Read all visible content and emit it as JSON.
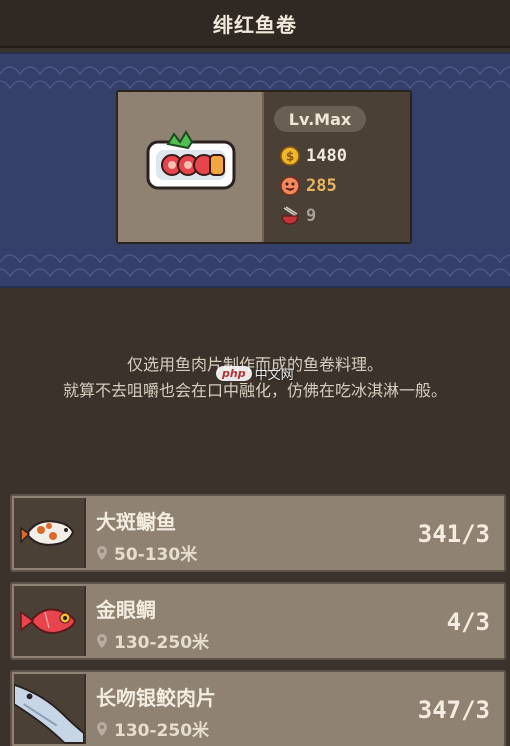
{
  "header": {
    "title": "绯红鱼卷"
  },
  "dish": {
    "image_icon": "salmon-roll-icon",
    "level": "Lv.Max",
    "price": "1480",
    "appeal": "285",
    "portions": "9"
  },
  "description": {
    "line1": "仅选用鱼肉片制作而成的鱼卷料理。",
    "line2": "就算不去咀嚼也会在口中融化，仿佛在吃冰淇淋一般。"
  },
  "watermark": {
    "badge": "php",
    "text": "中文网"
  },
  "ingredients": [
    {
      "name": "大斑鳚鱼",
      "location": "50-130米",
      "count": "341/3",
      "icon": "spotted-blenny-icon"
    },
    {
      "name": "金眼鲷",
      "location": "130-250米",
      "count": "4/3",
      "icon": "splendid-alfonsino-icon"
    },
    {
      "name": "长吻银鲛肉片",
      "location": "130-250米",
      "count": "347/3",
      "icon": "longnose-chimaera-icon"
    }
  ],
  "colors": {
    "background": "#3b322b",
    "banner": "#34406a",
    "card": "#8f8273",
    "gold": "#f0b72a",
    "heart": "#e8b562"
  }
}
